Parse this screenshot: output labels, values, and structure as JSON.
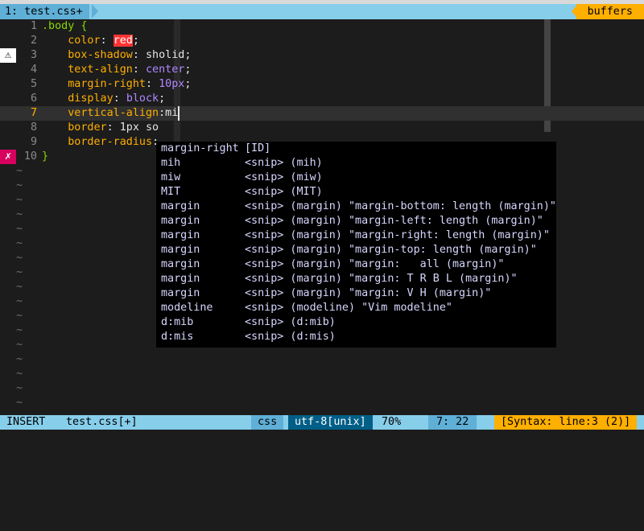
{
  "tabline": {
    "tab": "1: test.css+",
    "buffers": "buffers"
  },
  "lines": [
    {
      "num": "1",
      "parts": [
        [
          "sel",
          ".body {"
        ]
      ]
    },
    {
      "num": "2",
      "parts": [
        [
          "txt",
          "    "
        ],
        [
          "prop",
          "color"
        ],
        [
          "txt",
          ": "
        ],
        [
          "redval",
          "red"
        ],
        [
          "txt",
          ";"
        ]
      ]
    },
    {
      "num": "3",
      "parts": [
        [
          "txt",
          "    "
        ],
        [
          "prop",
          "box-shadow"
        ],
        [
          "txt",
          ": sholid;"
        ]
      ]
    },
    {
      "num": "4",
      "parts": [
        [
          "txt",
          "    "
        ],
        [
          "prop",
          "text-align"
        ],
        [
          "txt",
          ": "
        ],
        [
          "val",
          "center"
        ],
        [
          "txt",
          ";"
        ]
      ]
    },
    {
      "num": "5",
      "parts": [
        [
          "txt",
          "    "
        ],
        [
          "prop",
          "margin-right"
        ],
        [
          "txt",
          ": "
        ],
        [
          "num",
          "10px"
        ],
        [
          "txt",
          ";"
        ]
      ]
    },
    {
      "num": "6",
      "parts": [
        [
          "txt",
          "    "
        ],
        [
          "prop",
          "display"
        ],
        [
          "txt",
          ": "
        ],
        [
          "val",
          "block"
        ],
        [
          "txt",
          ";"
        ]
      ]
    },
    {
      "num": "7",
      "parts": [
        [
          "txt",
          "    "
        ],
        [
          "prop",
          "vertical-align"
        ],
        [
          "txt",
          ":mi"
        ]
      ]
    },
    {
      "num": "8",
      "parts": [
        [
          "txt",
          "    "
        ],
        [
          "prop",
          "border"
        ],
        [
          "txt",
          ": 1px so"
        ]
      ]
    },
    {
      "num": "9",
      "parts": [
        [
          "txt",
          "    "
        ],
        [
          "prop",
          "border-radius"
        ],
        [
          "txt",
          ":"
        ]
      ]
    },
    {
      "num": "10",
      "parts": [
        [
          "sel",
          "}"
        ]
      ]
    }
  ],
  "signs": {
    "warning_line": "3",
    "error_line": "10",
    "warning_glyph": "⚠",
    "error_glyph": "✗"
  },
  "tilde_count": 17,
  "completion": [
    [
      "margin-right",
      "[ID]"
    ],
    [
      "mih",
      "<snip> (mih)"
    ],
    [
      "miw",
      "<snip> (miw)"
    ],
    [
      "MIT",
      "<snip> (MIT)"
    ],
    [
      "margin",
      "<snip> (margin) \"margin-bottom: length (margin)\""
    ],
    [
      "margin",
      "<snip> (margin) \"margin-left: length (margin)\""
    ],
    [
      "margin",
      "<snip> (margin) \"margin-right: length (margin)\""
    ],
    [
      "margin",
      "<snip> (margin) \"margin-top: length (margin)\""
    ],
    [
      "margin",
      "<snip> (margin) \"margin:   all (margin)\""
    ],
    [
      "margin",
      "<snip> (margin) \"margin: T R B L (margin)\""
    ],
    [
      "margin",
      "<snip> (margin) \"margin: V H (margin)\""
    ],
    [
      "modeline",
      "<snip> (modeline) \"Vim modeline\""
    ],
    [
      "d:mib",
      "<snip> (d:mib)"
    ],
    [
      "d:mis",
      "<snip> (d:mis)"
    ]
  ],
  "status": {
    "mode": "INSERT",
    "file": "test.css[+]",
    "filetype": "css",
    "encoding": "utf-8[unix]",
    "percent": "70%",
    "position": "7: 22",
    "syntax": "[Syntax: line:3 (2)]"
  },
  "colors": {
    "tabline": "#87ceeb",
    "buffers": "#ffaf00",
    "selector": "#87d700",
    "property": "#ffaf00",
    "value": "#af87ff"
  }
}
